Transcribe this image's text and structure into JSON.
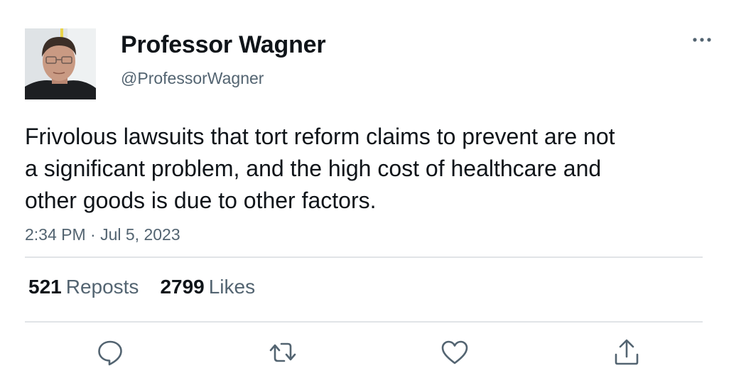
{
  "user": {
    "display_name": "Professor Wagner",
    "handle": "@ProfessorWagner",
    "avatar_icon": "profile-photo"
  },
  "tweet": {
    "text": "Frivolous lawsuits that tort reform claims to prevent are not a significant problem, and the high cost of healthcare and other goods is due to other factors.",
    "timestamp": "2:34 PM · Jul 5, 2023"
  },
  "stats": {
    "reposts_count": "521",
    "reposts_label": "Reposts",
    "likes_count": "2799",
    "likes_label": "Likes"
  },
  "actions": {
    "more_icon": "more-horizontal-icon",
    "reply_icon": "reply-icon",
    "retweet_icon": "retweet-icon",
    "like_icon": "heart-icon",
    "share_icon": "share-icon"
  },
  "colors": {
    "text_primary": "#0f1419",
    "text_secondary": "#536471",
    "divider": "#e1e4e7"
  }
}
